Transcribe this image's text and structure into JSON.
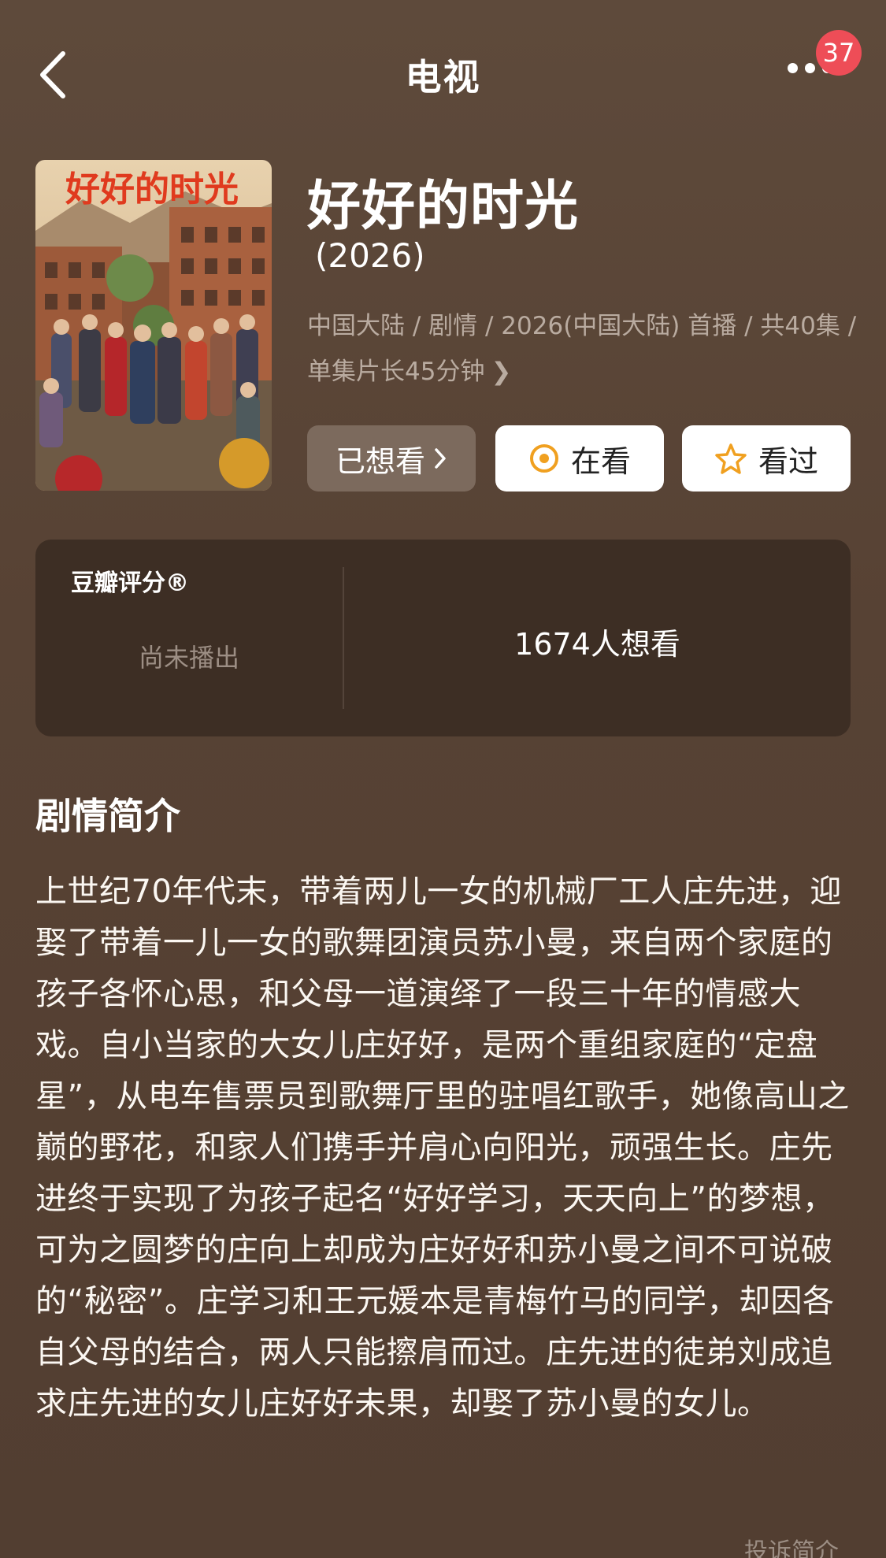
{
  "header": {
    "title": "电视",
    "notification_count": "37"
  },
  "icons": {
    "back": "chevron-left-icon",
    "more": "more-dots-icon",
    "watching": "target-icon",
    "watched": "star-icon"
  },
  "poster": {
    "title_art": "好好的时光"
  },
  "subject": {
    "title": "好好的时光",
    "year": "(2026)",
    "meta": "中国大陆 / 剧情 / 2026(中国大陆) 首播 / 共40集 / 单集片长45分钟"
  },
  "actions": {
    "wished_label": "已想看",
    "watching_label": "在看",
    "watched_label": "看过"
  },
  "rating": {
    "title": "豆瓣评分®",
    "status": "尚未播出",
    "wish_count": "1674人想看"
  },
  "synopsis": {
    "title": "剧情简介",
    "text": "上世纪70年代末，带着两儿一女的机械厂工人庄先进，迎娶了带着一儿一女的歌舞团演员苏小曼，来自两个家庭的孩子各怀心思，和父母一道演绎了一段三十年的情感大戏。自小当家的大女儿庄好好，是两个重组家庭的“定盘星”，从电车售票员到歌舞厅里的驻唱红歌手，她像高山之巅的野花，和家人们携手并肩心向阳光，顽强生长。庄先进终于实现了为孩子起名“好好学习，天天向上”的梦想，可为之圆梦的庄向上却成为庄好好和苏小曼之间不可说破的“秘密”。庄学习和王元媛本是青梅竹马的同学，却因各自父母的结合，两人只能擦肩而过。庄先进的徒弟刘成追求庄先进的女儿庄好好未果，却娶了苏小曼的女儿。",
    "report_label": "投诉简介"
  },
  "colors": {
    "background": "#574234",
    "card": "#3d2e24",
    "badge": "#ee4d57",
    "accent_orange": "#f0a020",
    "muted_text": "#b9aba0"
  }
}
